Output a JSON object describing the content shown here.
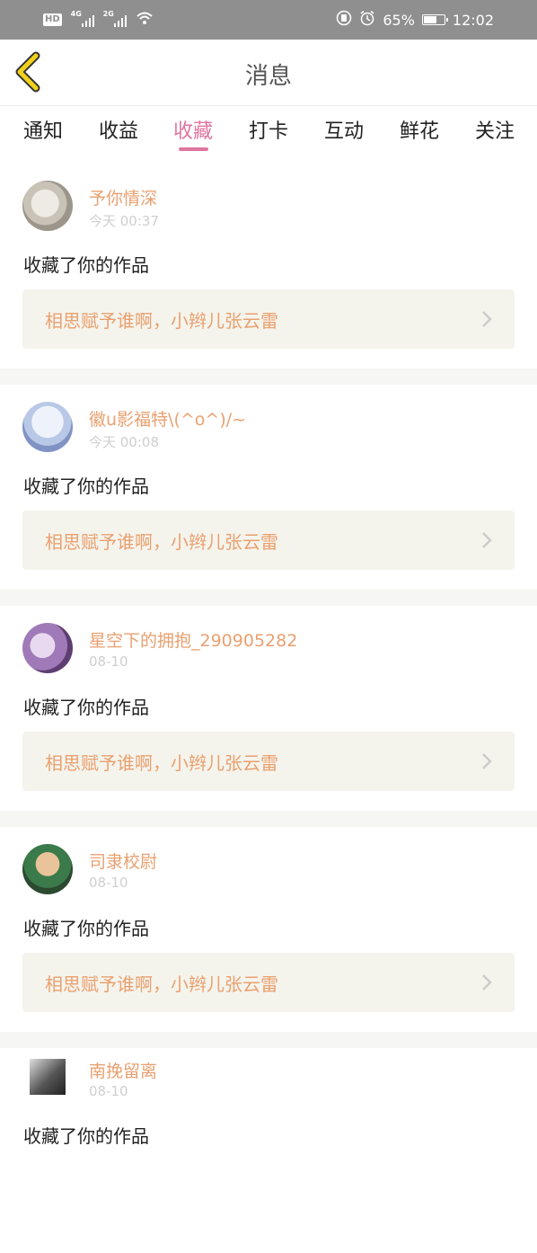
{
  "status_bar": {
    "hd": "HD",
    "network1": "4G",
    "network2": "2G",
    "battery_percent": "65%",
    "battery_level": 0.65,
    "time": "12:02"
  },
  "header": {
    "back_icon": "chevron-left-icon",
    "title": "消息"
  },
  "colors": {
    "accent": "#e075a0",
    "name": "#e9a070",
    "back": "#f2d11c",
    "card_bg": "#f5f4ec",
    "separator": "#f6f6f4"
  },
  "tabs": [
    {
      "label": "通知",
      "active": false
    },
    {
      "label": "收益",
      "active": false
    },
    {
      "label": "收藏",
      "active": true
    },
    {
      "label": "打卡",
      "active": false
    },
    {
      "label": "互动",
      "active": false
    },
    {
      "label": "鲜花",
      "active": false
    },
    {
      "label": "关注",
      "active": false
    }
  ],
  "items": [
    {
      "user": "予你情深",
      "time": "今天 00:37",
      "action": "收藏了你的作品",
      "work": "相思赋予谁啊，小辫儿张云雷"
    },
    {
      "user": "徽u影福特\\(^o^)/~",
      "time": "今天 00:08",
      "action": "收藏了你的作品",
      "work": "相思赋予谁啊，小辫儿张云雷"
    },
    {
      "user": "星空下的拥抱_290905282",
      "time": "08-10",
      "action": "收藏了你的作品",
      "work": "相思赋予谁啊，小辫儿张云雷"
    },
    {
      "user": "司隶校尉",
      "time": "08-10",
      "action": "收藏了你的作品",
      "work": "相思赋予谁啊，小辫儿张云雷"
    },
    {
      "user": "南挽留离",
      "time": "08-10",
      "action": "收藏了你的作品"
    }
  ]
}
